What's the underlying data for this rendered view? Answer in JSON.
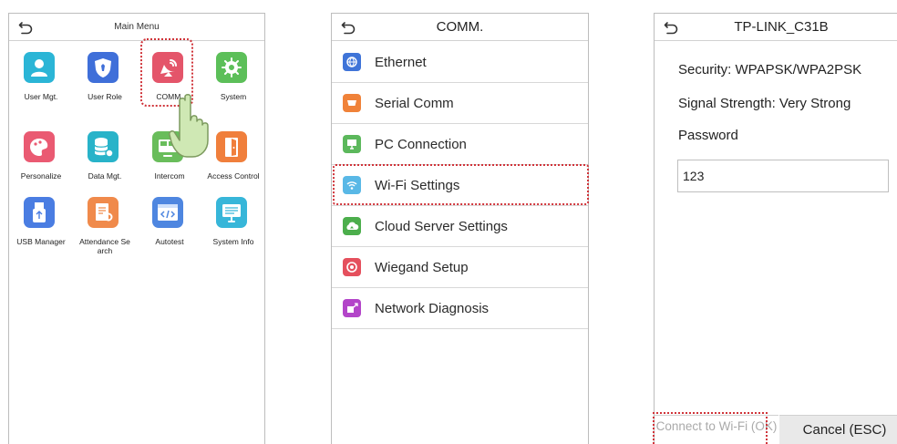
{
  "panel1": {
    "title": "Main Menu",
    "tiles": [
      {
        "label": "User Mgt.",
        "icon": "user-icon",
        "color": "#2bb5d6"
      },
      {
        "label": "User Role",
        "icon": "shield-icon",
        "color": "#3f6fd9"
      },
      {
        "label": "COMM.",
        "icon": "satellite-dish-icon",
        "color": "#e4556a"
      },
      {
        "label": "System",
        "icon": "gear-icon",
        "color": "#5cbf59"
      },
      {
        "label": "Personalize",
        "icon": "palette-icon",
        "color": "#ea5a72"
      },
      {
        "label": "Data Mgt.",
        "icon": "database-icon",
        "color": "#28b3c9"
      },
      {
        "label": "Intercom",
        "icon": "monitor-icon",
        "color": "#69bd5b"
      },
      {
        "label": "Access Control",
        "icon": "door-icon",
        "color": "#f07f3c"
      },
      {
        "label": "USB Manager",
        "icon": "usb-icon",
        "color": "#4a7de2"
      },
      {
        "label": "Attendance Se arch",
        "icon": "document-search-icon",
        "color": "#f08a4b"
      },
      {
        "label": "Autotest",
        "icon": "code-window-icon",
        "color": "#4e86e0"
      },
      {
        "label": "System Info",
        "icon": "computer-info-icon",
        "color": "#37b6d9"
      }
    ]
  },
  "panel2": {
    "title": "COMM.",
    "items": [
      {
        "label": "Ethernet",
        "icon": "globe-icon",
        "color": "#3f74d8"
      },
      {
        "label": "Serial Comm",
        "icon": "serial-port-icon",
        "color": "#f08239"
      },
      {
        "label": "PC Connection",
        "icon": "pc-icon",
        "color": "#5cb85c"
      },
      {
        "label": "Wi-Fi Settings",
        "icon": "wifi-icon",
        "color": "#59b8e6"
      },
      {
        "label": "Cloud Server Settings",
        "icon": "cloud-icon",
        "color": "#4cae4c"
      },
      {
        "label": "Wiegand Setup",
        "icon": "wiegand-icon",
        "color": "#e5505d"
      },
      {
        "label": "Network Diagnosis",
        "icon": "network-diagnosis-icon",
        "color": "#b345c9"
      }
    ]
  },
  "panel3": {
    "title": "TP-LINK_C31B",
    "security": "Security:  WPAPSK/WPA2PSK",
    "signal": "Signal Strength:  Very Strong",
    "password_label": "Password",
    "password_value": "123",
    "connect_label": "Connect to Wi-Fi (OK)",
    "cancel_label": "Cancel (ESC)"
  },
  "highlight_color": "#d0343a"
}
